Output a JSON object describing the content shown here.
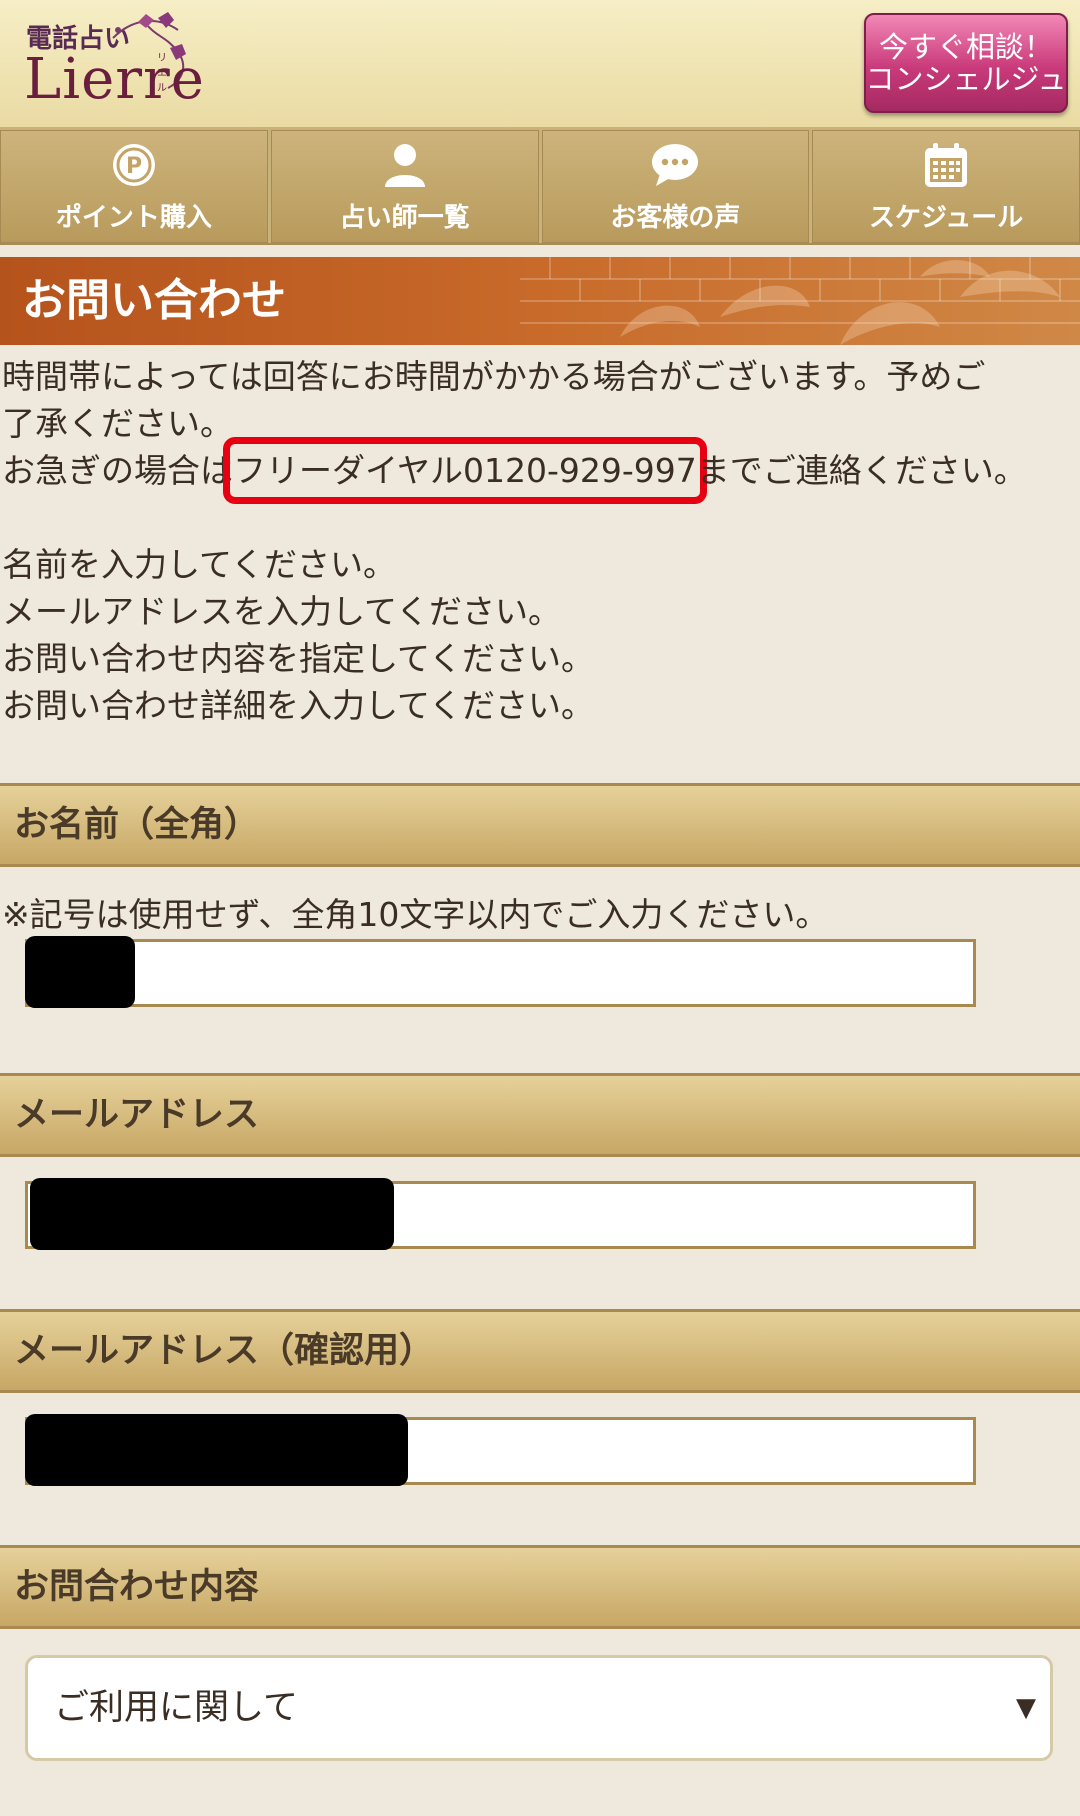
{
  "header": {
    "logo_top": "電話占い",
    "logo_main": "Lierre",
    "logo_sub": "リエル",
    "cta_line1": "今すぐ相談！",
    "cta_line2": "コンシェルジュ"
  },
  "nav": [
    {
      "label": "ポイント購入",
      "icon": "point-icon"
    },
    {
      "label": "占い師一覧",
      "icon": "person-icon"
    },
    {
      "label": "お客様の声",
      "icon": "chat-bubble-icon"
    },
    {
      "label": "スケジュール",
      "icon": "calendar-icon"
    }
  ],
  "page": {
    "title": "お問い合わせ"
  },
  "notice": {
    "line1": "時間帯によっては回答にお時間がかかる場合がございます。予めご",
    "line2": "了承ください。",
    "line3_prefix": "お急ぎの場合は",
    "line3_phone": "フリーダイヤル0120-929-997",
    "line3_suffix": "までご連絡ください。",
    "errors": [
      "名前を入力してください。",
      "メールアドレスを入力してください。",
      "お問い合わせ内容を指定してください。",
      "お問い合わせ詳細を入力してください。"
    ]
  },
  "form": {
    "name_label": "お名前（全角）",
    "name_hint": "※記号は使用せず、全角10文字以内でご入力ください。",
    "email_label": "メールアドレス",
    "email_confirm_label": "メールアドレス（確認用）",
    "inquiry_label": "お問合わせ内容",
    "inquiry_selected": "ご利用に関して"
  },
  "colors": {
    "highlight": "#e60012",
    "title_bar": "#c0621f",
    "cta": "#c93a7a"
  }
}
